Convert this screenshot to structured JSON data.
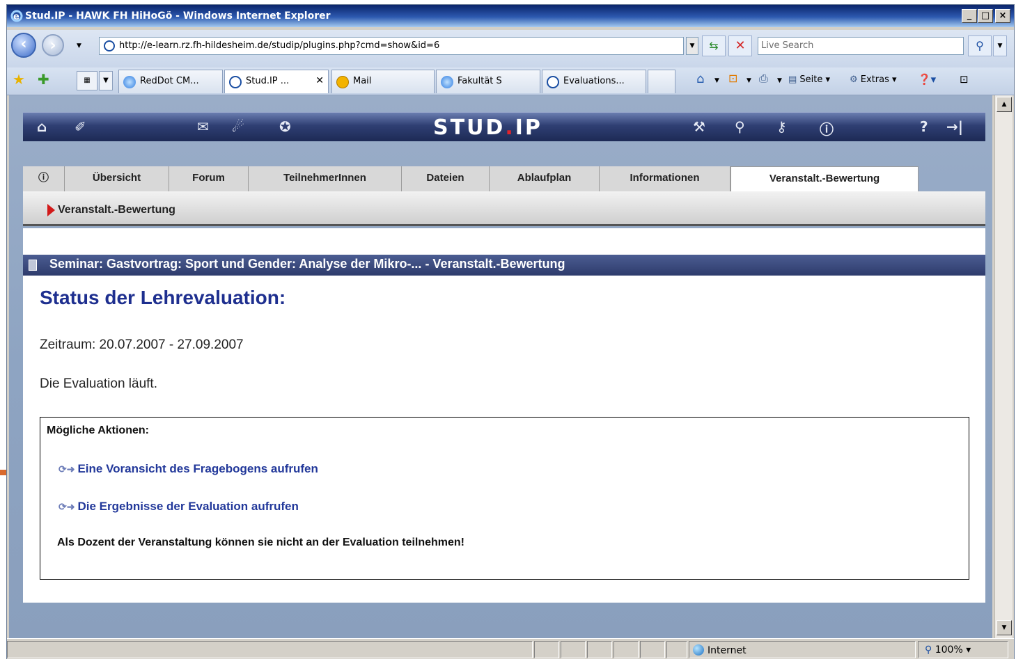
{
  "window": {
    "title": "Stud.IP - HAWK FH HiHoGö - Windows Internet Explorer",
    "controls": [
      "_",
      "□",
      "×"
    ]
  },
  "addressbar": {
    "url": "http://e-learn.rz.fh-hildesheim.de/studip/plugins.php?cmd=show&id=6",
    "search_placeholder": "Live Search"
  },
  "browser_tabs": [
    {
      "label": "RedDot CM...",
      "icon": "ie-icon"
    },
    {
      "label": "Stud.IP ...",
      "icon": "studip-icon",
      "active": true
    },
    {
      "label": "Mail",
      "icon": "mail-icon"
    },
    {
      "label": "Fakultät S",
      "icon": "ie-icon"
    },
    {
      "label": "Evaluations...",
      "icon": "studip-icon"
    }
  ],
  "command_bar": {
    "page_label": "Seite",
    "tools_label": "Extras"
  },
  "studip": {
    "logo_main": "STUD",
    "logo_dot": ".",
    "logo_end": "IP",
    "nav_tabs": [
      "Übersicht",
      "Forum",
      "TeilnehmerInnen",
      "Dateien",
      "Ablaufplan",
      "Informationen",
      "Veranstalt.-Bewertung"
    ],
    "info_tab": "ⓘ",
    "active_tab": "Veranstalt.-Bewertung",
    "subnav_label": "Veranstalt.-Bewertung"
  },
  "main": {
    "seminar_header": "Seminar: Gastvortrag: Sport und Gender: Analyse der Mikro-... - Veranstalt.-Bewertung",
    "status_title": "Status der Lehrevaluation:",
    "period": "Zeitraum: 20.07.2007 - 27.09.2007",
    "running": "Die Evaluation läuft.",
    "actions_heading": "Mögliche Aktionen:",
    "action_preview": "Eine Voransicht des Fragebogens aufrufen",
    "action_results": "Die Ergebnisse der Evaluation aufrufen",
    "lecturer_note": "Als Dozent der Veranstaltung können sie nicht an der Evaluation teilnehmen!"
  },
  "statusbar": {
    "zone": "Internet",
    "zoom": "100%"
  },
  "colors": {
    "title_blue": "#1e2f8f",
    "link_blue": "#22389a",
    "header_navy": "#2e3b6c",
    "annotation_orange": "#d9692c",
    "logo_dot_red": "#e3232a"
  }
}
